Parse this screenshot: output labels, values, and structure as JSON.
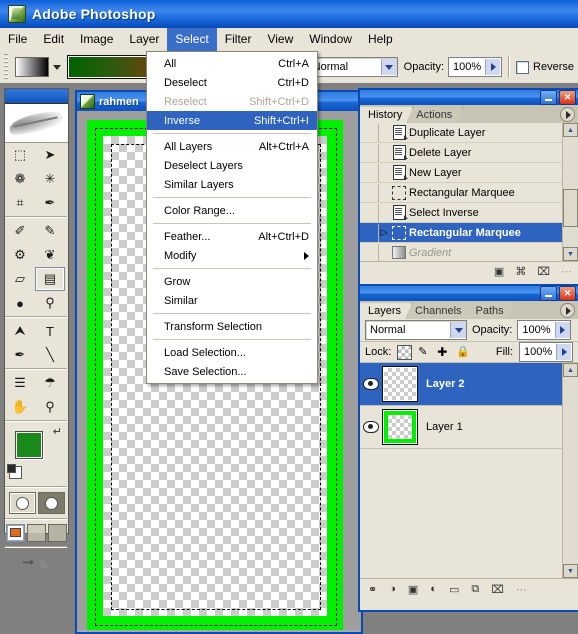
{
  "app": {
    "title": "Adobe Photoshop",
    "icon": "photoshop-feather-icon"
  },
  "menubar": {
    "items": [
      {
        "label": "File",
        "active": false
      },
      {
        "label": "Edit",
        "active": false
      },
      {
        "label": "Image",
        "active": false
      },
      {
        "label": "Layer",
        "active": false
      },
      {
        "label": "Select",
        "active": true
      },
      {
        "label": "Filter",
        "active": false
      },
      {
        "label": "View",
        "active": false
      },
      {
        "label": "Window",
        "active": false
      },
      {
        "label": "Help",
        "active": false
      }
    ]
  },
  "options_bar": {
    "gradient_picker_label": "gradient-preset-swatch",
    "gradient_preview_label": "gradient-preview",
    "mode_label": ":",
    "mode_value": "Normal",
    "opacity_label": "Opacity:",
    "opacity_value": "100%",
    "reverse_label": "Reverse"
  },
  "toolbox": {
    "tools": [
      {
        "name": "rectangular-marquee-tool",
        "glyph": "⬚",
        "selected": false
      },
      {
        "name": "move-tool",
        "glyph": "➤",
        "selected": false
      },
      {
        "name": "lasso-tool",
        "glyph": "❁",
        "selected": false
      },
      {
        "name": "magic-wand-tool",
        "glyph": "✳",
        "selected": false
      },
      {
        "name": "crop-tool",
        "glyph": "⌗",
        "selected": false
      },
      {
        "name": "slice-tool",
        "glyph": "✒",
        "selected": false
      },
      {
        "name": "healing-brush-tool",
        "glyph": "✐",
        "selected": false
      },
      {
        "name": "brush-tool",
        "glyph": "✎",
        "selected": false
      },
      {
        "name": "clone-stamp-tool",
        "glyph": "⚙",
        "selected": false
      },
      {
        "name": "history-brush-tool",
        "glyph": "❦",
        "selected": false
      },
      {
        "name": "eraser-tool",
        "glyph": "▱",
        "selected": false
      },
      {
        "name": "gradient-tool",
        "glyph": "▤",
        "selected": true
      },
      {
        "name": "blur-tool",
        "glyph": "●",
        "selected": false
      },
      {
        "name": "dodge-tool",
        "glyph": "⚲",
        "selected": false
      },
      {
        "name": "path-selection-tool",
        "glyph": "⮝",
        "selected": false
      },
      {
        "name": "type-tool",
        "glyph": "T",
        "selected": false
      },
      {
        "name": "pen-tool",
        "glyph": "✒",
        "selected": false
      },
      {
        "name": "line-tool",
        "glyph": "╲",
        "selected": false
      },
      {
        "name": "notes-tool",
        "glyph": "☰",
        "selected": false
      },
      {
        "name": "eyedropper-tool",
        "glyph": "☂",
        "selected": false
      },
      {
        "name": "hand-tool",
        "glyph": "✋",
        "selected": false
      },
      {
        "name": "zoom-tool",
        "glyph": "⚲",
        "selected": false
      }
    ],
    "foreground_color": "#1a8a1a",
    "background_color": "#ef0000",
    "swap_icon": "swap-colors-icon",
    "default_colors_icon": "default-colors-icon",
    "quickmask_standard": "standard-mode-icon",
    "quickmask_mask": "quick-mask-mode-icon",
    "screen_modes": [
      "standard-screen-mode",
      "full-screen-with-menubar",
      "full-screen-mode"
    ],
    "jump_to_imageready": "jump-to-imageready-icon"
  },
  "document": {
    "title": "rahmen",
    "icon": "document-icon",
    "canvas_color": "#00f000",
    "has_selection": true
  },
  "select_menu": {
    "items": [
      {
        "label": "All",
        "accel": "Ctrl+A",
        "type": "item"
      },
      {
        "label": "Deselect",
        "accel": "Ctrl+D",
        "type": "item"
      },
      {
        "label": "Reselect",
        "accel": "Shift+Ctrl+D",
        "type": "item",
        "disabled": true
      },
      {
        "label": "Inverse",
        "accel": "Shift+Ctrl+I",
        "type": "item",
        "highlighted": true
      },
      {
        "type": "separator"
      },
      {
        "label": "All Layers",
        "accel": "Alt+Ctrl+A",
        "type": "item"
      },
      {
        "label": "Deselect Layers",
        "accel": "",
        "type": "item"
      },
      {
        "label": "Similar Layers",
        "accel": "",
        "type": "item"
      },
      {
        "type": "separator"
      },
      {
        "label": "Color Range...",
        "accel": "",
        "type": "item"
      },
      {
        "type": "separator"
      },
      {
        "label": "Feather...",
        "accel": "Alt+Ctrl+D",
        "type": "item"
      },
      {
        "label": "Modify",
        "accel": "",
        "type": "submenu"
      },
      {
        "type": "separator"
      },
      {
        "label": "Grow",
        "accel": "",
        "type": "item"
      },
      {
        "label": "Similar",
        "accel": "",
        "type": "item"
      },
      {
        "type": "separator"
      },
      {
        "label": "Transform Selection",
        "accel": "",
        "type": "item"
      },
      {
        "type": "separator"
      },
      {
        "label": "Load Selection...",
        "accel": "",
        "type": "item"
      },
      {
        "label": "Save Selection...",
        "accel": "",
        "type": "item"
      }
    ]
  },
  "history_panel": {
    "tabs": [
      {
        "label": "History",
        "active": true
      },
      {
        "label": "Actions",
        "active": false
      }
    ],
    "items": [
      {
        "label": "Duplicate Layer",
        "icon": "document-state-icon",
        "state": "normal"
      },
      {
        "label": "Delete Layer",
        "icon": "document-state-icon",
        "state": "normal"
      },
      {
        "label": "New Layer",
        "icon": "document-state-icon",
        "state": "normal"
      },
      {
        "label": "Rectangular Marquee",
        "icon": "marquee-state-icon",
        "state": "normal"
      },
      {
        "label": "Select Inverse",
        "icon": "document-state-icon",
        "state": "normal"
      },
      {
        "label": "Rectangular Marquee",
        "icon": "marquee-state-icon",
        "state": "current"
      },
      {
        "label": "Gradient",
        "icon": "gradient-state-icon",
        "state": "undone"
      }
    ],
    "footer_buttons": [
      {
        "name": "create-document-from-state-icon",
        "glyph": "▣"
      },
      {
        "name": "create-new-snapshot-icon",
        "glyph": "⌘"
      },
      {
        "name": "delete-state-trash-icon",
        "glyph": "⌧"
      }
    ],
    "window_buttons": {
      "minimize": "–",
      "close": "✕"
    }
  },
  "layers_panel": {
    "tabs": [
      {
        "label": "Layers",
        "active": true
      },
      {
        "label": "Channels",
        "active": false
      },
      {
        "label": "Paths",
        "active": false
      }
    ],
    "blend_mode": "Normal",
    "opacity_label": "Opacity:",
    "opacity_value": "100%",
    "lock_label": "Lock:",
    "lock_icons": [
      "lock-transparency-icon",
      "lock-image-pixels-icon",
      "lock-position-icon",
      "lock-all-icon"
    ],
    "fill_label": "Fill:",
    "fill_value": "100%",
    "layers": [
      {
        "name": "Layer 2",
        "visible": true,
        "selected": true,
        "thumb": "transparent"
      },
      {
        "name": "Layer 1",
        "visible": true,
        "selected": false,
        "thumb": "green-frame"
      }
    ],
    "footer_buttons": [
      {
        "name": "link-layers-icon",
        "glyph": "⚭"
      },
      {
        "name": "layer-style-icon",
        "glyph": "◑"
      },
      {
        "name": "layer-mask-icon",
        "glyph": "▣"
      },
      {
        "name": "adjustment-layer-icon",
        "glyph": "◐"
      },
      {
        "name": "new-group-icon",
        "glyph": "▭"
      },
      {
        "name": "new-layer-icon",
        "glyph": "⧉"
      },
      {
        "name": "delete-layer-trash-icon",
        "glyph": "⌧"
      }
    ],
    "window_buttons": {
      "minimize": "–",
      "close": "✕"
    }
  },
  "colors": {
    "title_blue": "#0a4ab4",
    "panel_bg": "#e8e5d8",
    "highlight_blue": "#2f63c0",
    "canvas_green": "#00f000"
  }
}
